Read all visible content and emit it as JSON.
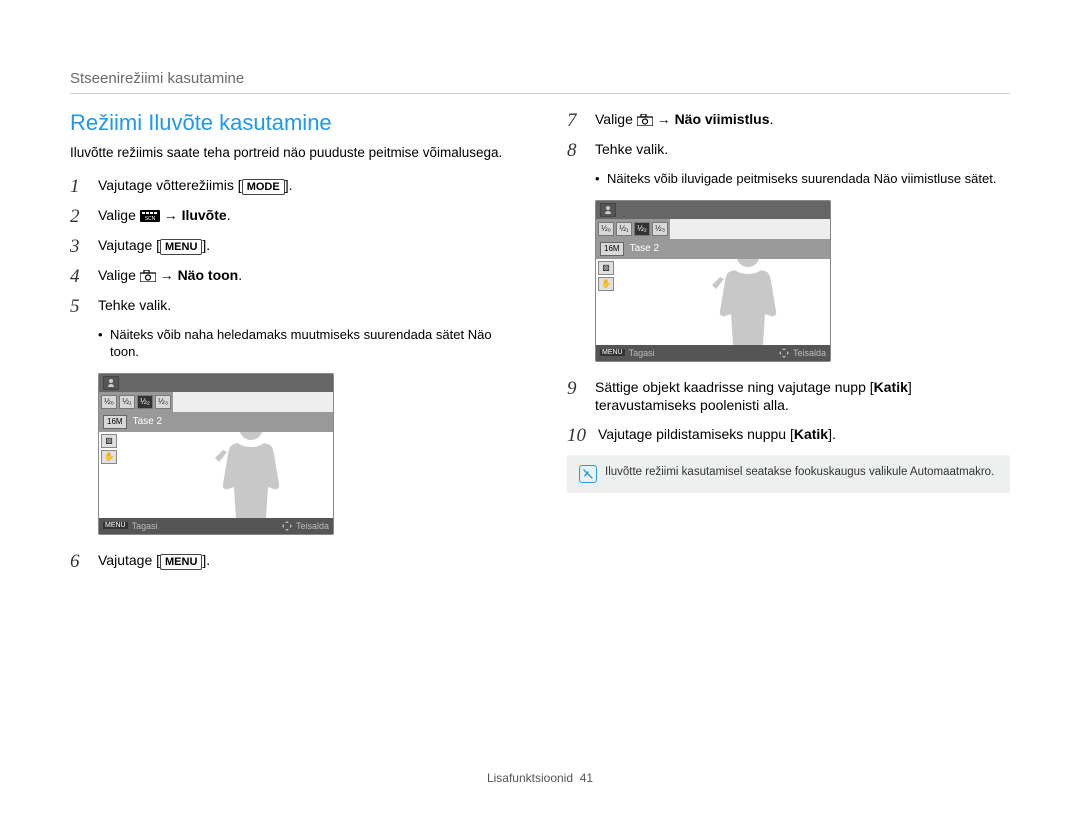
{
  "breadcrumb": "Stseenirežiimi kasutamine",
  "section_title": "Režiimi Iluvõte kasutamine",
  "intro": "Iluvõtte režiimis saate teha portreid näo puuduste peitmise võimalusega.",
  "left_steps": {
    "s1": {
      "num": "1",
      "pre": "Vajutage võtterežiimis [",
      "btn": "MODE",
      "post": "]."
    },
    "s2": {
      "num": "2",
      "pre": "Valige ",
      "arrow": "→",
      "bold": "Iluvõte",
      "post": "."
    },
    "s3": {
      "num": "3",
      "pre": "Vajutage [",
      "btn": "MENU",
      "post": "]."
    },
    "s4": {
      "num": "4",
      "pre": "Valige ",
      "arrow": "→",
      "bold": "Näo toon",
      "post": "."
    },
    "s5": {
      "num": "5",
      "text": "Tehke valik."
    },
    "s5_sub": "Näiteks võib naha heledamaks muutmiseks suurendada sätet Näo toon.",
    "s6": {
      "num": "6",
      "pre": "Vajutage [",
      "btn": "MENU",
      "post": "]."
    }
  },
  "right_steps": {
    "s7": {
      "num": "7",
      "pre": "Valige ",
      "arrow": "→",
      "bold": "Näo viimistlus",
      "post": "."
    },
    "s8": {
      "num": "8",
      "text": "Tehke valik."
    },
    "s8_sub": "Näiteks võib iluvigade peitmiseks suurendada Näo viimistluse sätet.",
    "s9": {
      "num": "9",
      "pre": "Sättige objekt kaadrisse ning vajutage nupp [",
      "bold": "Katik",
      "post": "] teravustamiseks poolenisti alla."
    },
    "s10": {
      "num": "10",
      "pre": "Vajutage pildistamiseks nuppu [",
      "bold": "Katik",
      "post": "]."
    }
  },
  "camera_screen": {
    "level_values": [
      "½₀",
      "½₁",
      "½₂",
      "½₃"
    ],
    "size_label": "16M",
    "tase_label": "Tase 2",
    "footer_left_tag": "MENU",
    "footer_left": "Tagasi",
    "footer_right": "Teisalda"
  },
  "info_box": "Iluvõtte režiimi kasutamisel seatakse fookuskaugus valikule Automaatmakro.",
  "page_footer_label": "Lisafunktsioonid",
  "page_footer_num": "41"
}
